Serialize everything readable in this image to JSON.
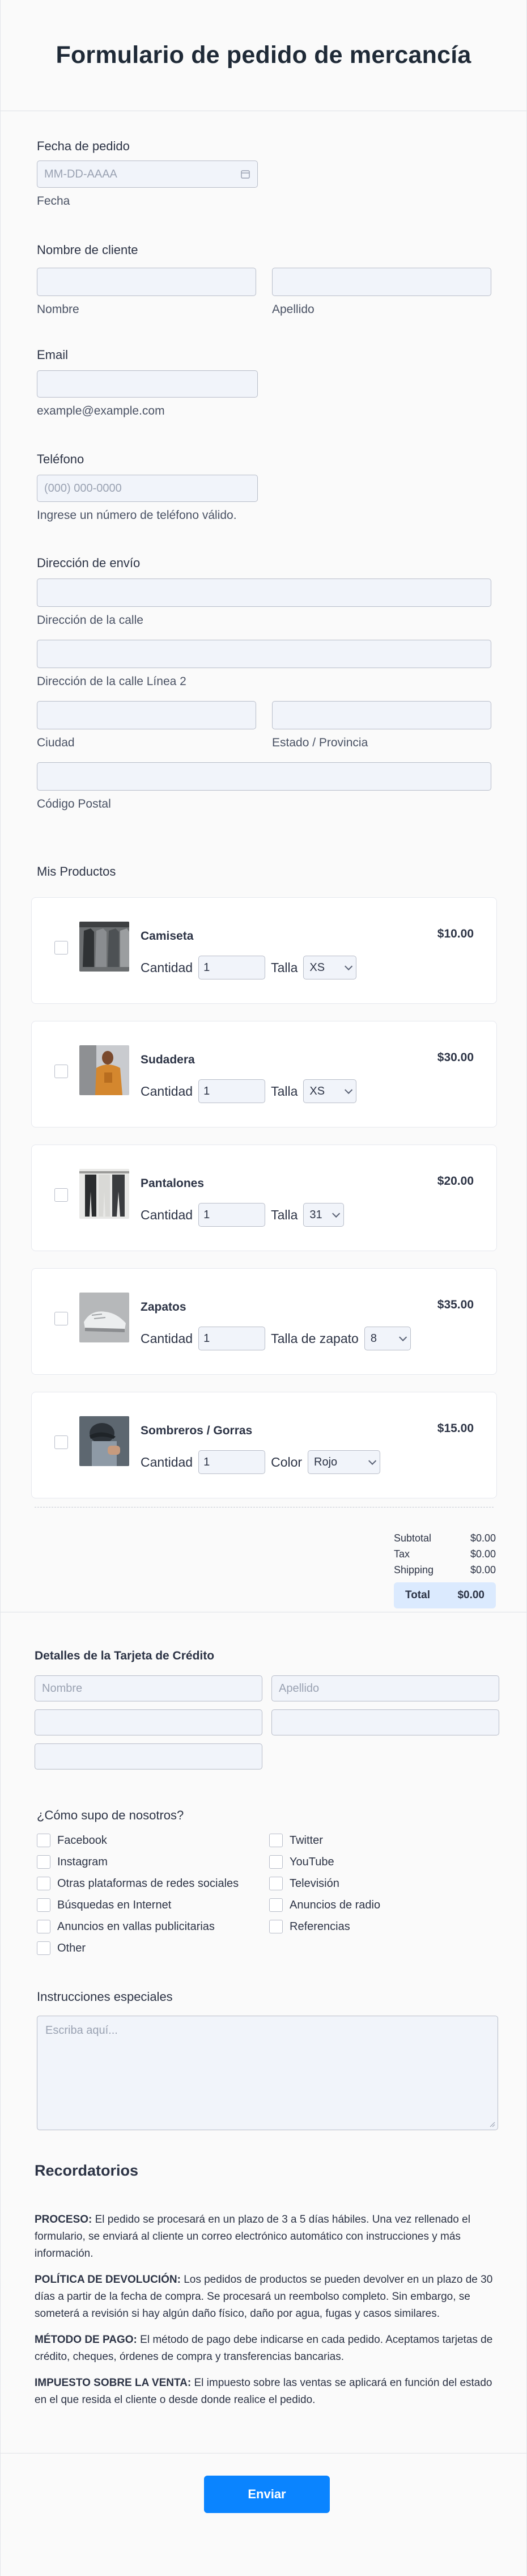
{
  "form": {
    "title": "Formulario de pedido de mercancía"
  },
  "order_date": {
    "label": "Fecha de pedido",
    "placeholder": "MM-DD-AAAA",
    "sublabel": "Fecha",
    "icon": "calendar-icon"
  },
  "customer_name": {
    "label": "Nombre de cliente",
    "first_sublabel": "Nombre",
    "last_sublabel": "Apellido"
  },
  "email": {
    "label": "Email",
    "sublabel": "example@example.com"
  },
  "phone": {
    "label": "Teléfono",
    "placeholder": "(000) 000-0000",
    "sublabel": "Ingrese un número de teléfono válido."
  },
  "address": {
    "label": "Dirección de envío",
    "street": "Dirección de la calle",
    "street2": "Dirección de la calle Línea 2",
    "city": "Ciudad",
    "state": "Estado / Provincia",
    "zip": "Código Postal"
  },
  "products": {
    "label": "Mis Productos",
    "qty_label": "Cantidad",
    "items": [
      {
        "name": "Camiseta",
        "price": "$10.00",
        "qty": "1",
        "option_label": "Talla",
        "option_value": "XS"
      },
      {
        "name": "Sudadera",
        "price": "$30.00",
        "qty": "1",
        "option_label": "Talla",
        "option_value": "XS"
      },
      {
        "name": "Pantalones",
        "price": "$20.00",
        "qty": "1",
        "option_label": "Talla",
        "option_value": "31"
      },
      {
        "name": "Zapatos",
        "price": "$35.00",
        "qty": "1",
        "option_label": "Talla de zapato",
        "option_value": "8"
      },
      {
        "name": "Sombreros / Gorras",
        "price": "$15.00",
        "qty": "1",
        "option_label": "Color",
        "option_value": "Rojo"
      }
    ]
  },
  "totals": {
    "subtotal_label": "Subtotal",
    "subtotal": "$0.00",
    "tax_label": "Tax",
    "tax": "$0.00",
    "shipping_label": "Shipping",
    "shipping": "$0.00",
    "total_label": "Total",
    "total": "$0.00"
  },
  "credit_card": {
    "label": "Detalles de la Tarjeta de Crédito",
    "first_placeholder": "Nombre",
    "last_placeholder": "Apellido"
  },
  "referral": {
    "label": "¿Cómo supo de nosotros?",
    "left": [
      "Facebook",
      "Instagram",
      "Otras plataformas de redes sociales",
      "Búsquedas en Internet",
      "Anuncios en vallas publicitarias",
      "Other"
    ],
    "right": [
      "Twitter",
      "YouTube",
      "Televisión",
      "Anuncios de radio",
      "Referencias"
    ]
  },
  "instructions": {
    "label": "Instrucciones especiales",
    "placeholder": "Escriba aquí..."
  },
  "reminders": {
    "title": "Recordatorios",
    "items": [
      {
        "head": "PROCESO:",
        "text": " El pedido se procesará en un plazo de 3 a 5 días hábiles. Una vez rellenado el formulario, se enviará al cliente un correo electrónico automático con instrucciones y más información."
      },
      {
        "head": "POLÍTICA DE DEVOLUCIÓN:",
        "text": " Los pedidos de productos se pueden devolver en un plazo de 30 días a partir de la fecha de compra. Se procesará un reembolso completo. Sin embargo, se someterá a revisión si hay algún daño físico, daño por agua, fugas y casos similares."
      },
      {
        "head": "MÉTODO DE PAGO:",
        "text": " El método de pago debe indicarse en cada pedido. Aceptamos tarjetas de crédito, cheques, órdenes de compra y transferencias bancarias."
      },
      {
        "head": "IMPUESTO SOBRE LA VENTA:",
        "text": " El impuesto sobre las ventas se aplicará en función del estado en el que resida el cliente o desde donde realice el pedido."
      }
    ]
  },
  "submit": {
    "label": "Enviar"
  },
  "colors": {
    "accent": "#0a84ff",
    "total_bg": "#dbeafe"
  }
}
